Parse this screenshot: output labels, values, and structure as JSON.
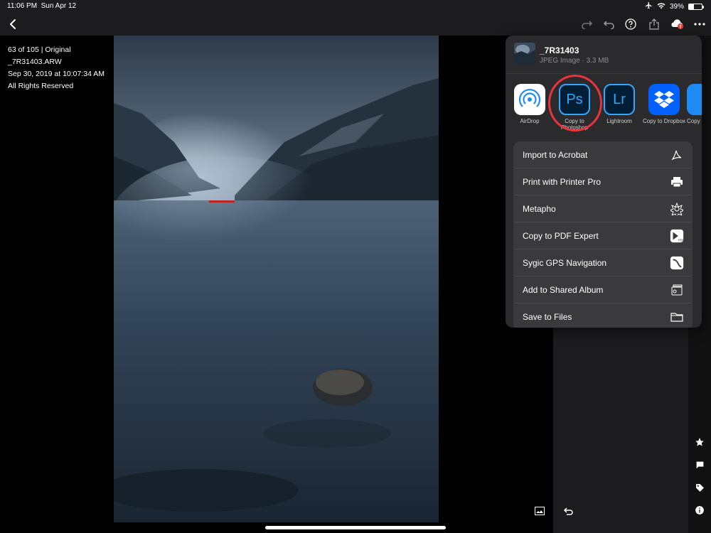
{
  "status_bar": {
    "time": "11:06 PM",
    "date": "Sun Apr 12",
    "battery": "39%",
    "battery_level": 0.39
  },
  "photo_meta": {
    "position": "63 of 105 | Original",
    "filename": "_7R31403.ARW",
    "datetime": "Sep 30, 2019 at 10:07:34 AM",
    "rights": "All Rights Reserved"
  },
  "share_sheet": {
    "title": "_7R31403",
    "subtitle": "JPEG Image · 3.3 MB",
    "apps": [
      {
        "label": "AirDrop",
        "icon": "airdrop-icon"
      },
      {
        "label": "Copy to Photoshop",
        "icon": "photoshop-icon",
        "glyph": "Ps"
      },
      {
        "label": "Lightroom",
        "icon": "lightroom-icon",
        "glyph": "Lr"
      },
      {
        "label": "Copy to Dropbox",
        "icon": "dropbox-icon"
      },
      {
        "label": "Copy",
        "icon": "app-icon"
      }
    ],
    "actions": [
      {
        "label": "Import to Acrobat",
        "icon": "acrobat-icon"
      },
      {
        "label": "Print with Printer Pro",
        "icon": "printer-icon"
      },
      {
        "label": "Metapho",
        "icon": "metapho-icon"
      },
      {
        "label": "Copy to PDF Expert",
        "icon": "pdf-expert-icon"
      },
      {
        "label": "Sygic GPS Navigation",
        "icon": "gps-navigation-icon"
      },
      {
        "label": "Add to Shared Album",
        "icon": "shared-album-icon"
      },
      {
        "label": "Save to Files",
        "icon": "folder-icon"
      }
    ]
  },
  "colors": {
    "toolbar_bg": "#1c1c1e",
    "sheet_bg": "#2b2b2d",
    "row_bg": "#3a3a3c",
    "highlight": "#e8343c",
    "photoshop_blue": "#31a8ff",
    "lightroom_blue": "#31a8ff",
    "dropbox_blue": "#0061fe",
    "badge_red": "#e0443e"
  }
}
